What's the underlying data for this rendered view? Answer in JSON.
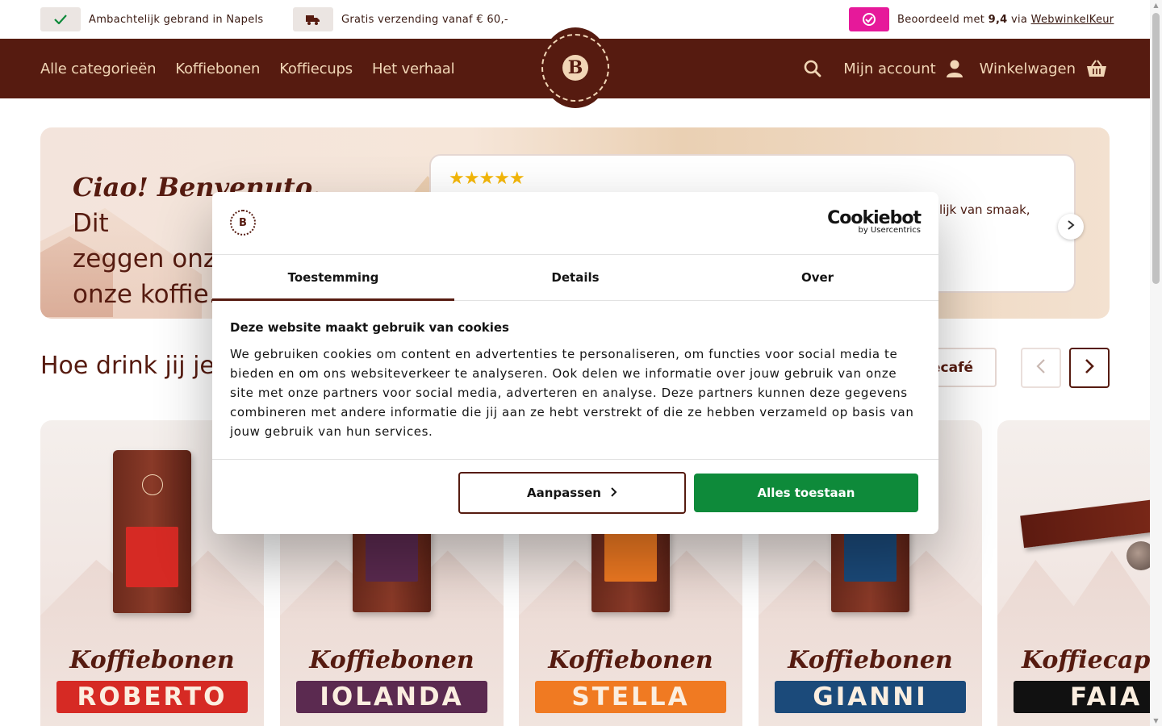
{
  "usp": {
    "item1": "Ambachtelijk gebrand in Napels",
    "item2": "Gratis verzending vanaf € 60,-",
    "rating_prefix": "Beoordeeld met",
    "rating_value": "9,4",
    "rating_via": "via",
    "rating_link": "WebwinkelKeur"
  },
  "nav": {
    "items": [
      "Alle categorieën",
      "Koffiebonen",
      "Koffiecups",
      "Het verhaal"
    ],
    "account": "Mijn account",
    "cart": "Winkelwagen"
  },
  "logo": {
    "letter": "B"
  },
  "hero": {
    "greeting": "Ciao! Benvenuto.",
    "text_line1": " Dit",
    "text_line2": "zeggen onze",
    "text_line3": "onze koffie.",
    "stars": "★★★★★",
    "review_fragment": "lijk van smaak,"
  },
  "section": {
    "title": "Hoe drink jij je A",
    "filter_label": "ecafé"
  },
  "products": [
    {
      "type": "Koffiebonen",
      "name": "ROBERTO",
      "color": "#d62a24"
    },
    {
      "type": "Koffiebonen",
      "name": "IOLANDA",
      "color": "#5b2a50"
    },
    {
      "type": "Koffiebonen",
      "name": "STELLA",
      "color": "#f07a22"
    },
    {
      "type": "Koffiebonen",
      "name": "GIANNI",
      "color": "#1b4a7a"
    },
    {
      "type": "Koffiecaps",
      "name": "FAIA",
      "color": "#111111"
    }
  ],
  "cookie": {
    "brand": "Cookiebot",
    "brand_sub": "by Usercentrics",
    "tabs": [
      "Toestemming",
      "Details",
      "Over"
    ],
    "heading": "Deze website maakt gebruik van cookies",
    "body": "We gebruiken cookies om content en advertenties te personaliseren, om functies voor social media te bieden en om ons websiteverkeer te analyseren. Ook delen we informatie over jouw gebruik van onze site met onze partners voor social media, adverteren en analyse. Deze partners kunnen deze gegevens combineren met andere informatie die jij aan ze hebt verstrekt of die ze hebben verzameld op basis van jouw gebruik van hun services.",
    "adjust_label": "Aanpassen",
    "allow_label": "Alles toestaan"
  },
  "colors": {
    "brand_brown": "#561b10",
    "accent_cream": "#f1d6b6",
    "allow_green": "#0e8a3a",
    "rating_pink": "#e6199a"
  }
}
